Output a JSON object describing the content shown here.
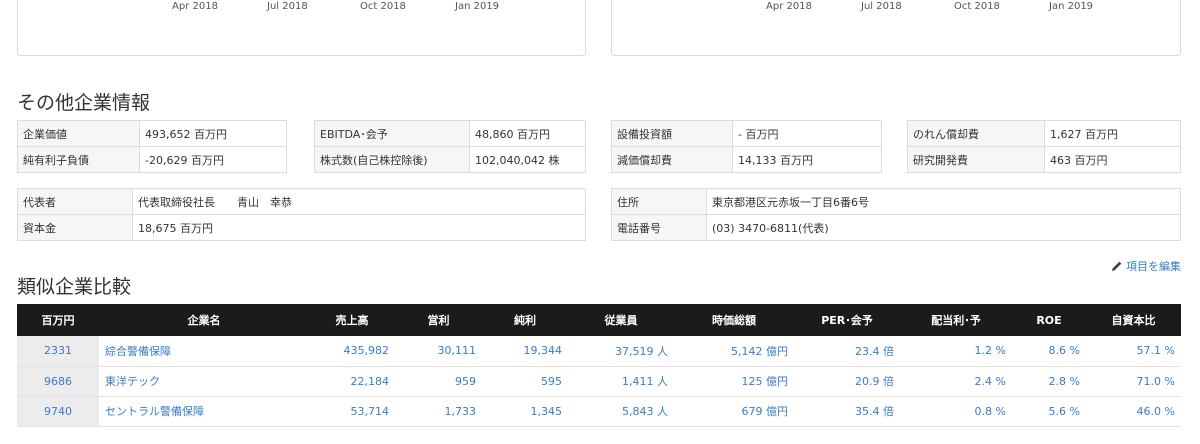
{
  "charts": {
    "left_ticks": [
      "Apr 2018",
      "Jul 2018",
      "Oct 2018",
      "Jan 2019"
    ],
    "right_ticks": [
      "Apr 2018",
      "Jul 2018",
      "Oct 2018",
      "Jan 2019"
    ]
  },
  "other_info": {
    "title": "その他企業情報",
    "grid": [
      [
        {
          "label": "企業価値",
          "value": "493,652 百万円"
        },
        {
          "label": "純有利子負債",
          "value": "-20,629 百万円"
        }
      ],
      [
        {
          "label": "EBITDA･会予",
          "value": "48,860 百万円"
        },
        {
          "label": "株式数(自己株控除後)",
          "value": "102,040,042 株"
        }
      ],
      [
        {
          "label": "設備投資額",
          "value": "- 百万円"
        },
        {
          "label": "減価償却費",
          "value": "14,133 百万円"
        }
      ],
      [
        {
          "label": "のれん償却費",
          "value": "1,627 百万円"
        },
        {
          "label": "研究開発費",
          "value": "463 百万円"
        }
      ]
    ],
    "company": [
      {
        "label": "代表者",
        "value": "代表取締役社長　　青山　幸恭"
      },
      {
        "label": "資本金",
        "value": "18,675 百万円"
      }
    ],
    "contact": [
      {
        "label": "住所",
        "value": "東京都港区元赤坂一丁目6番6号"
      },
      {
        "label": "電話番号",
        "value": "(03) 3470-6811(代表)"
      }
    ]
  },
  "comparison": {
    "title": "類似企業比較",
    "edit_label": "項目を編集",
    "columns": [
      "百万円",
      "企業名",
      "売上高",
      "営利",
      "純利",
      "従業員",
      "時価総額",
      "PER･会予",
      "配当利･予",
      "ROE",
      "自資本比"
    ],
    "rows": [
      {
        "code": "2331",
        "name": "綜合警備保障",
        "sales": "435,982",
        "op": "30,111",
        "net": "19,344",
        "emp": "37,519 人",
        "mcap": "5,142 億円",
        "per": "23.4 倍",
        "div": "1.2 %",
        "roe": "8.6 %",
        "equity": "57.1 %"
      },
      {
        "code": "9686",
        "name": "東洋テック",
        "sales": "22,184",
        "op": "959",
        "net": "595",
        "emp": "1,411 人",
        "mcap": "125 億円",
        "per": "20.9 倍",
        "div": "2.4 %",
        "roe": "2.8 %",
        "equity": "71.0 %"
      },
      {
        "code": "9740",
        "name": "セントラル警備保障",
        "sales": "53,714",
        "op": "1,733",
        "net": "1,345",
        "emp": "5,843 人",
        "mcap": "679 億円",
        "per": "35.4 倍",
        "div": "0.8 %",
        "roe": "5.6 %",
        "equity": "46.0 %"
      }
    ]
  },
  "colors": {
    "link": "#3a7cc2",
    "header_bg": "#1b1b1b"
  }
}
